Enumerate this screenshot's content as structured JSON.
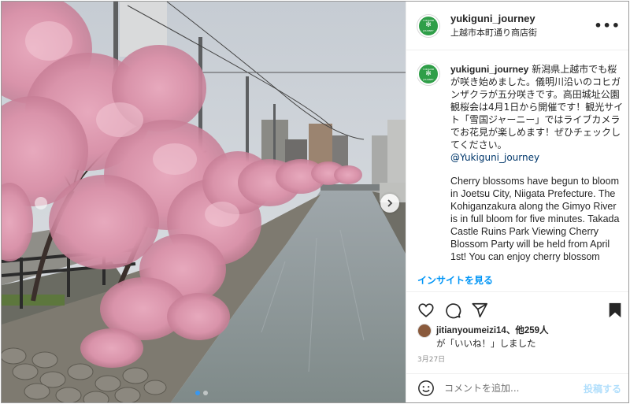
{
  "post": {
    "username": "yukiguni_journey",
    "location": "上越市本町通り商店街",
    "avatar_icon": "yukiguni-logo",
    "avatar_color": "#2f9e48"
  },
  "caption": {
    "username": "yukiguni_journey",
    "text_ja": "新潟県上越市でも桜が咲き始めました。儀明川沿いのコヒガンザクラが五分咲きです。高田城址公園観桜会は4月1日から開催です！観光サイト「雪国ジャーニー」ではライブカメラでお花見が楽しめます！ぜひチェックしてください。",
    "mention": "@Yukiguni_journey",
    "text_en": "Cherry blossoms have begun to bloom in Joetsu City, Niigata Prefecture. The Kohiganzakura along the Gimyo River is in full bloom for five minutes. Takada Castle Ruins Park Viewing Cherry Blossom Party will be held from April 1st! You can enjoy cherry blossom"
  },
  "insights_label": "インサイトを見る",
  "likes": {
    "first_user": "jitianyoumeizi14",
    "others": "、他259人",
    "suffix": "が「いいね！」しました"
  },
  "date": "3月27日",
  "comment": {
    "placeholder": "コメントを追加...",
    "post_label": "投稿する"
  },
  "carousel": {
    "count": 2,
    "active_index": 0
  },
  "colors": {
    "accent": "#0095f6",
    "text": "#262626",
    "muted": "#8e8e8e"
  }
}
